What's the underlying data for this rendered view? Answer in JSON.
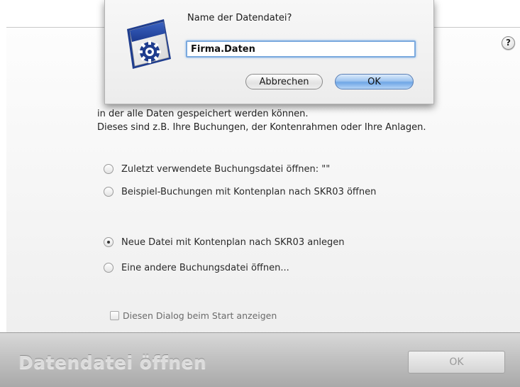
{
  "dialog": {
    "prompt": "Name der Datendatei?",
    "filename_value": "Firma.Daten",
    "cancel_label": "Abbrechen",
    "ok_label": "OK"
  },
  "window": {
    "help_label": "?",
    "intro_lines": [
      "in der alle Daten gespeichert werden können.",
      "Dieses sind z.B. Ihre Buchungen, der Kontenrahmen oder Ihre Anlagen."
    ],
    "options": [
      {
        "label": "Zuletzt verwendete Buchungsdatei öffnen: \"\"",
        "selected": false
      },
      {
        "label": "Beispiel-Buchungen mit Kontenplan nach SKR03 öffnen",
        "selected": false
      },
      {
        "label": "Neue Datei mit Kontenplan nach SKR03 anlegen",
        "selected": true
      },
      {
        "label": "Eine andere Buchungsdatei öffnen...",
        "selected": false
      }
    ],
    "startup_checkbox_label": "Diesen Dialog beim Start anzeigen",
    "startup_checkbox_checked": false
  },
  "footer": {
    "title": "Datendatei öffnen",
    "ok_label": "OK"
  },
  "colors": {
    "focus_ring": "#7aa9de",
    "default_button": "#6fa6e6",
    "footer_background": "#c2c2c2"
  },
  "icons": {
    "app_icon": "gear-document-icon",
    "help": "help-icon"
  }
}
